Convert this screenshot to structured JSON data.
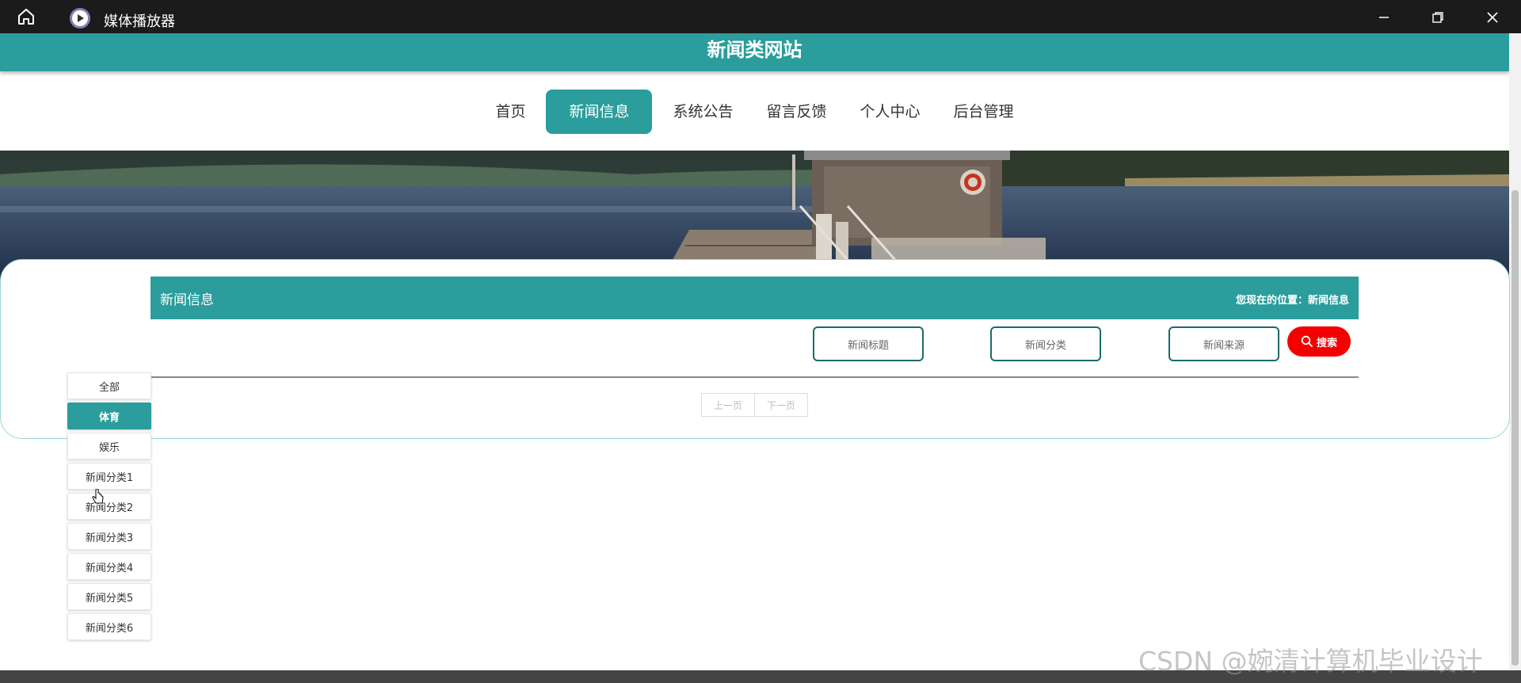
{
  "window": {
    "title": "媒体播放器"
  },
  "site": {
    "title": "新闻类网站"
  },
  "nav": [
    "首页",
    "新闻信息",
    "系统公告",
    "留言反馈",
    "个人中心",
    "后台管理"
  ],
  "section": {
    "title": "新闻信息",
    "location_label": "您现在的位置：新闻信息"
  },
  "search": {
    "title_placeholder": "新闻标题",
    "category_placeholder": "新闻分类",
    "source_placeholder": "新闻来源",
    "button_label": "搜索"
  },
  "pager": {
    "prev": "上一页",
    "next": "下一页"
  },
  "categories": [
    "全部",
    "体育",
    "娱乐",
    "新闻分类1",
    "新闻分类2",
    "新闻分类3",
    "新闻分类4",
    "新闻分类5",
    "新闻分类6"
  ],
  "active_category": "体育",
  "active_nav": "新闻信息",
  "watermark": "CSDN @婉清计算机毕业设计",
  "colors": {
    "accent": "#2a9d9c",
    "search_button": "#f40000",
    "titlebar": "#1b1b1b"
  }
}
